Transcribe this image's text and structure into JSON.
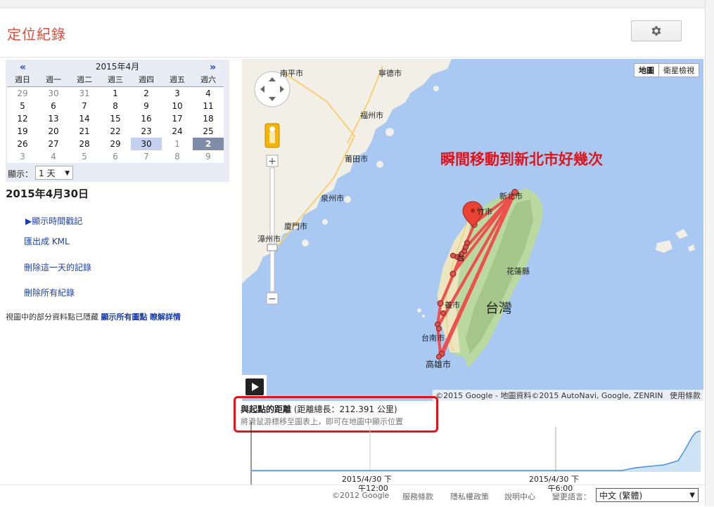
{
  "app": {
    "title": "定位紀錄"
  },
  "calendar": {
    "month_label": "2015年4月",
    "prev": "«",
    "next": "»",
    "weekdays": [
      "週日",
      "週一",
      "週二",
      "週三",
      "週四",
      "週五",
      "週六"
    ],
    "weeks": [
      [
        "29",
        "30",
        "31",
        "1",
        "2",
        "3",
        "4"
      ],
      [
        "5",
        "6",
        "7",
        "8",
        "9",
        "10",
        "11"
      ],
      [
        "12",
        "13",
        "14",
        "15",
        "16",
        "17",
        "18"
      ],
      [
        "19",
        "20",
        "21",
        "22",
        "23",
        "24",
        "25"
      ],
      [
        "26",
        "27",
        "28",
        "29",
        "30",
        "1",
        "2"
      ],
      [
        "3",
        "4",
        "5",
        "6",
        "7",
        "8",
        "9"
      ]
    ],
    "selected_day": "30",
    "today_day": "2"
  },
  "display": {
    "label": "顯示：",
    "value": "1 天"
  },
  "date_heading": "2015年4月30日",
  "actions": {
    "show_timestamps": "▶顯示時間戳記",
    "export_kml": "匯出成 KML",
    "delete_day": "刪除這一天的記錄",
    "delete_all": "刪除所有紀錄"
  },
  "note": {
    "text": "視圖中的部分資料點已隱藏",
    "show_all": "顯示所有圖點",
    "learn_more": "瞭解詳情"
  },
  "map": {
    "type_map": "地圖",
    "type_satellite": "衛星檢視",
    "annotation": "瞬間移動到新北市好幾次",
    "attribution": "©2015 Google - 地圖資料©2015 AutoNavi, Google, ZENRIN",
    "terms": "使用條款",
    "labels": {
      "nanping": "南平市",
      "ningde": "寧德市",
      "fuzhou": "福州市",
      "putian": "莆田市",
      "quanzhou": "泉州市",
      "xiamen": "廈門市",
      "zhangzhou": "漳州市",
      "newtaipei": "新北市",
      "taipei_frag": "竹市",
      "taichung_frag": "台",
      "hualien": "花蓮縣",
      "taiwan": "台灣",
      "chiayi_frag": "義市",
      "tainan": "台南市",
      "kaohsiung": "高雄市"
    }
  },
  "chart": {
    "title": "與起點的距離",
    "total": "(距離總長：212.391 公里)",
    "hint": "將滑鼠游標移至圖表上，即可在地圖中顯示位置",
    "ticks": [
      {
        "date": "2015/4/30 下",
        "time": "午12:00"
      },
      {
        "date": "2015/4/30 下",
        "time": "午6:00"
      }
    ]
  },
  "footer": {
    "copyright": "©2012 Google",
    "terms": "服務條款",
    "privacy": "隱私權政策",
    "help": "說明中心",
    "language_label": "變更語言：",
    "language_value": "中文 (繁體)"
  },
  "colors": {
    "brand_red": "#dd4b39",
    "link_blue": "#1a3ea8",
    "route_red": "#f04a4a",
    "annotation_red": "#e0141b"
  }
}
